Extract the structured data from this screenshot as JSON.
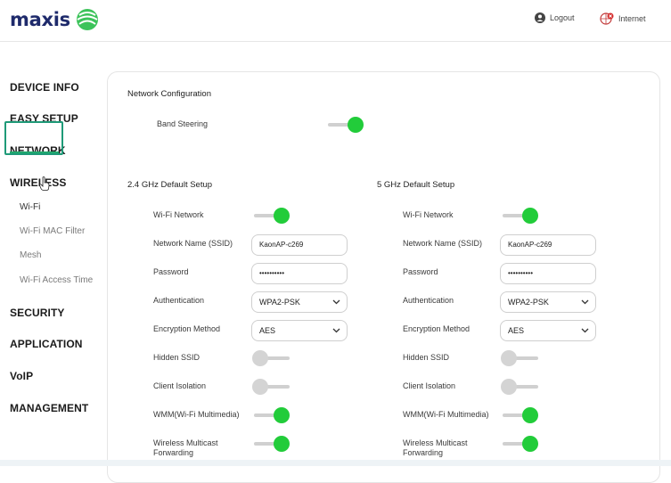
{
  "header": {
    "brand": "maxis",
    "logout_label": "Logout",
    "internet_label": "Internet"
  },
  "sidebar": {
    "items": [
      {
        "label": "DEVICE INFO"
      },
      {
        "label": "EASY SETUP"
      },
      {
        "label": "NETWORK"
      },
      {
        "label": "WIRELESS"
      },
      {
        "label": "SECURITY"
      },
      {
        "label": "APPLICATION"
      },
      {
        "label": "VoIP"
      },
      {
        "label": "MANAGEMENT"
      }
    ],
    "wireless_sub": [
      {
        "label": "Wi-Fi",
        "active": true
      },
      {
        "label": "Wi-Fi MAC Filter",
        "active": false
      },
      {
        "label": "Mesh",
        "active": false
      },
      {
        "label": "Wi-Fi Access Time",
        "active": false
      }
    ]
  },
  "network_config": {
    "title": "Network Configuration",
    "band_steering_label": "Band Steering",
    "band_steering": true
  },
  "band24": {
    "title": "2.4 GHz Default Setup",
    "wifi_network_label": "Wi-Fi Network",
    "wifi_network": true,
    "ssid_label": "Network Name (SSID)",
    "ssid": "KaonAP-c269",
    "password_label": "Password",
    "password": "••••••••••",
    "auth_label": "Authentication",
    "auth": "WPA2-PSK",
    "encryption_label": "Encryption Method",
    "encryption": "AES",
    "hidden_ssid_label": "Hidden SSID",
    "hidden_ssid": false,
    "client_isolation_label": "Client Isolation",
    "client_isolation": false,
    "wmm_label": "WMM(Wi-Fi Multimedia)",
    "wmm": true,
    "multicast_label_1": "Wireless Multicast",
    "multicast_label_2": "Forwarding",
    "multicast": true
  },
  "band5": {
    "title": "5 GHz Default Setup",
    "wifi_network_label": "Wi-Fi Network",
    "wifi_network": true,
    "ssid_label": "Network Name (SSID)",
    "ssid": "KaonAP-c269",
    "password_label": "Password",
    "password": "••••••••••",
    "auth_label": "Authentication",
    "auth": "WPA2-PSK",
    "encryption_label": "Encryption Method",
    "encryption": "AES",
    "hidden_ssid_label": "Hidden SSID",
    "hidden_ssid": false,
    "client_isolation_label": "Client Isolation",
    "client_isolation": false,
    "wmm_label": "WMM(Wi-Fi Multimedia)",
    "wmm": true,
    "multicast_label_1": "Wireless Multicast",
    "multicast_label_2": "Forwarding",
    "multicast": true
  },
  "colors": {
    "brand_navy": "#1e2a6b",
    "brand_green": "#1fa86d",
    "toggle_on": "#22cc3a",
    "toggle_off": "#d4d4d4"
  }
}
